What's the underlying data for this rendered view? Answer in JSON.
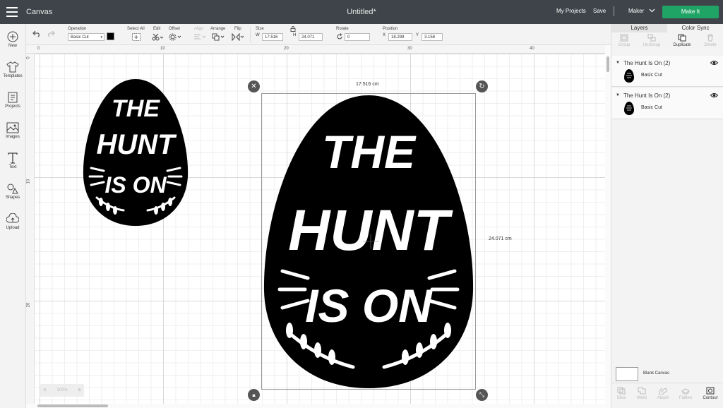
{
  "topbar": {
    "app_title": "Canvas",
    "document_title": "Untitled*",
    "my_projects": "My Projects",
    "save": "Save",
    "machine": "Maker",
    "make_it": "Make It"
  },
  "toolbar": {
    "operation_label": "Operation",
    "operation_value": "Basic Cut",
    "select_all": "Select All",
    "edit": "Edit",
    "offset": "Offset",
    "align": "Align",
    "arrange": "Arrange",
    "flip": "Flip",
    "size_label": "Size",
    "w_label": "W",
    "w_value": "17.516",
    "h_label": "H",
    "h_value": "24.071",
    "rotate_label": "Rotate",
    "rotate_value": "0",
    "position_label": "Position",
    "x_label": "X",
    "x_value": "18.299",
    "y_label": "Y",
    "y_value": "3.158",
    "operation_color": "#000000"
  },
  "leftbar": [
    {
      "label": "New",
      "icon": "plus-circle-icon"
    },
    {
      "label": "Templates",
      "icon": "tshirt-icon"
    },
    {
      "label": "Projects",
      "icon": "projects-icon"
    },
    {
      "label": "Images",
      "icon": "image-icon"
    },
    {
      "label": "Text",
      "icon": "text-icon"
    },
    {
      "label": "Shapes",
      "icon": "shapes-icon"
    },
    {
      "label": "Upload",
      "icon": "upload-icon"
    }
  ],
  "ruler": {
    "top": [
      "0",
      "10",
      "20",
      "30",
      "40"
    ],
    "left": [
      "0",
      "10",
      "20"
    ]
  },
  "canvas": {
    "selection_width": "17.516 cm",
    "selection_height": "24.071 cm",
    "zoom": "100%",
    "design_text": [
      "THE",
      "HUNT",
      "IS ON"
    ]
  },
  "rightpanel": {
    "tabs": [
      "Layers",
      "Color Sync"
    ],
    "actions": [
      "Group",
      "UnGroup",
      "Duplicate",
      "Delete"
    ],
    "layers": [
      {
        "name": "The Hunt Is On (2)",
        "sub": "Basic Cut"
      },
      {
        "name": "The Hunt Is On (2)",
        "sub": "Basic Cut"
      }
    ],
    "blank_canvas": "Blank Canvas",
    "bottom_actions": [
      "Slice",
      "Weld",
      "Attach",
      "Flatten",
      "Contour"
    ]
  },
  "colors": {
    "topbar": "#3e4449",
    "make_it": "#20a466",
    "design_fill": "#000000"
  }
}
